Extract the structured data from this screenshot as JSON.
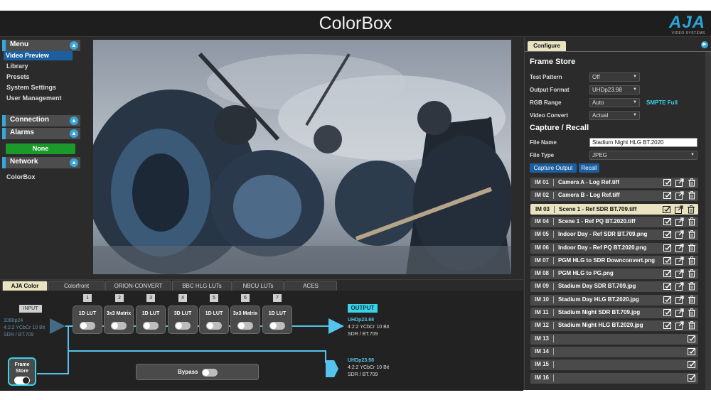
{
  "app": {
    "title": "ColorBox",
    "logo": "AJA",
    "logo_sub": "VIDEO SYSTEMS"
  },
  "sidebar": {
    "menu": {
      "label": "Menu",
      "items": [
        "Video Preview",
        "Library",
        "Presets",
        "System Settings",
        "User Management"
      ],
      "active": "Video Preview"
    },
    "connection": {
      "label": "Connection"
    },
    "alarms": {
      "label": "Alarms",
      "status": "None"
    },
    "network": {
      "label": "Network",
      "device": "ColorBox"
    }
  },
  "pipeline": {
    "tabs": [
      "AJA Color",
      "Colorfront",
      "ORION-CONVERT",
      "BBC HLG LUTs",
      "NBCU LUTs",
      "ACES"
    ],
    "active_tab": "AJA Color",
    "input_label": "INPUT",
    "output_label": "OUTPUT",
    "input_format": {
      "res": "1080p24",
      "line2": "4:2:2 YCbCr 10 Bit",
      "line3": "SDR / BT.709"
    },
    "output_format_1": {
      "res": "UHDp23.98",
      "line2": "4:2:2 YCbCr 10 Bit",
      "line3": "SDR / BT.709"
    },
    "output_format_2": {
      "res": "UHDp23.98",
      "line2": "4:2:2 YCbCr 10 Bit",
      "line3": "SDR / BT.709"
    },
    "stages": [
      {
        "num": "1",
        "label": "1D LUT"
      },
      {
        "num": "2",
        "label": "3x3 Matrix"
      },
      {
        "num": "3",
        "label": "1D LUT"
      },
      {
        "num": "4",
        "label": "3D LUT"
      },
      {
        "num": "5",
        "label": "1D LUT"
      },
      {
        "num": "6",
        "label": "3x3 Matrix"
      },
      {
        "num": "7",
        "label": "1D LUT"
      }
    ],
    "frame_store": {
      "line1": "Frame",
      "line2": "Store",
      "enabled": true
    },
    "bypass": {
      "label": "Bypass",
      "enabled": false
    },
    "colors": {
      "accent": "#3ad2e9",
      "path": "#55c3ec"
    }
  },
  "configure": {
    "tab": "Configure",
    "frame_store_title": "Frame Store",
    "fields": [
      {
        "label": "Test Pattern",
        "value": "Off"
      },
      {
        "label": "Output Format",
        "value": "UHDp23.98"
      },
      {
        "label": "RGB Range",
        "value": "Auto",
        "note": "SMPTE Full"
      },
      {
        "label": "Video Convert",
        "value": "Actual"
      }
    ],
    "capture_title": "Capture / Recall",
    "file_name_label": "File Name",
    "file_name": "Stadium Night HLG BT.2020",
    "file_type_label": "File Type",
    "file_type": "JPEG",
    "capture_button": "Capture Output",
    "recall_button": "Recall",
    "slots": [
      {
        "id": "IM 01",
        "name": "Camera A - Log Ref.tiff"
      },
      {
        "id": "IM 02",
        "name": "Camera B - Log Ref.tiff"
      },
      {
        "id": "IM 03",
        "name": "Scene 1 - Ref SDR BT.709.tiff",
        "selected": true
      },
      {
        "id": "IM 04",
        "name": "Scene 1 - Ref PQ BT.2020.tiff"
      },
      {
        "id": "IM 05",
        "name": "Indoor Day - Ref SDR BT.709.png"
      },
      {
        "id": "IM 06",
        "name": "Indoor Day - Ref PQ BT.2020.png"
      },
      {
        "id": "IM 07",
        "name": "PGM HLG to SDR Downconvert.png"
      },
      {
        "id": "IM 08",
        "name": "PGM HLG to PG.png"
      },
      {
        "id": "IM 09",
        "name": "Stadium Day SDR BT.709.jpg"
      },
      {
        "id": "IM 10",
        "name": "Stadium Day HLG BT.2020.jpg"
      },
      {
        "id": "IM 11",
        "name": "Stadium Night SDR BT.709.jpg"
      },
      {
        "id": "IM 12",
        "name": "Stadium Night HLG BT.2020.jpg"
      },
      {
        "id": "IM 13",
        "name": ""
      },
      {
        "id": "IM 14",
        "name": ""
      },
      {
        "id": "IM 15",
        "name": ""
      },
      {
        "id": "IM 16",
        "name": ""
      }
    ]
  }
}
